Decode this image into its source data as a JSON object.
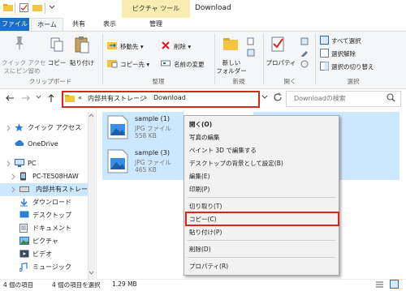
{
  "window": {
    "title": "Download",
    "contextual_tab": "ピクチャ ツール"
  },
  "tabs": {
    "file": "ファイル",
    "home": "ホーム",
    "share": "共有",
    "view": "表示",
    "manage": "管理"
  },
  "ribbon": {
    "clipboard": {
      "pin_label_1": "クイック アクセ",
      "pin_label_2": "スにピン留め",
      "copy": "コピー",
      "paste": "貼り付け",
      "group": "クリップボード"
    },
    "organize": {
      "move_to": "移動先 ▾",
      "copy_to": "コピー先 ▾",
      "delete": "削除 ▾",
      "rename": "名前の変更",
      "group": "整理"
    },
    "new": {
      "new_folder_1": "新しい",
      "new_folder_2": "フォルダー",
      "group": "新規"
    },
    "open": {
      "properties": "プロパティ",
      "group": "開く"
    },
    "select": {
      "select_all": "すべて選択",
      "select_none": "選択解除",
      "invert": "選択の切り替え",
      "group": "選択"
    }
  },
  "address": {
    "prefix": "«",
    "crumb1": "内部共有ストレージ",
    "arrow": "›",
    "crumb2": "Download",
    "search_placeholder": "Downloadの検索"
  },
  "nav": {
    "items": [
      {
        "label": "クイック アクセス",
        "icon": "star-icon"
      },
      {
        "label": "OneDrive",
        "icon": "cloud-icon"
      },
      {
        "label": "PC",
        "icon": "pc-icon"
      },
      {
        "label": "PC-TE508HAW",
        "icon": "device-icon"
      },
      {
        "label": "内部共有ストレー",
        "icon": "drive-icon"
      },
      {
        "label": "ダウンロード",
        "icon": "download-icon"
      },
      {
        "label": "デスクトップ",
        "icon": "desktop-icon"
      },
      {
        "label": "ドキュメント",
        "icon": "documents-icon"
      },
      {
        "label": "ピクチャ",
        "icon": "pictures-icon"
      },
      {
        "label": "ビデオ",
        "icon": "video-icon"
      },
      {
        "label": "ミュージック",
        "icon": "music-icon"
      }
    ]
  },
  "files": [
    {
      "name": "sample (1)",
      "type": "JPG ファイル",
      "size": "558 KB"
    },
    {
      "name": "sample (3)",
      "type": "JPG ファイル",
      "size": "465 KB"
    }
  ],
  "context_menu": {
    "items": [
      "開く(O)",
      "写真の編集",
      "ペイント 3D で編集する",
      "デスクトップの背景として設定(B)",
      "編集(E)",
      "印刷(P)",
      "切り取り(T)",
      "コピー(C)",
      "貼り付け(P)",
      "削除(D)",
      "プロパティ(R)"
    ]
  },
  "status": {
    "count": "4 個の項目",
    "selected": "4 個の項目を選択",
    "size": "1.29 MB"
  },
  "colors": {
    "accent": "#1a6fc9",
    "selection": "#cce8ff",
    "highlight_box": "#d9261c",
    "contextual_tab": "#f7ecb2"
  }
}
